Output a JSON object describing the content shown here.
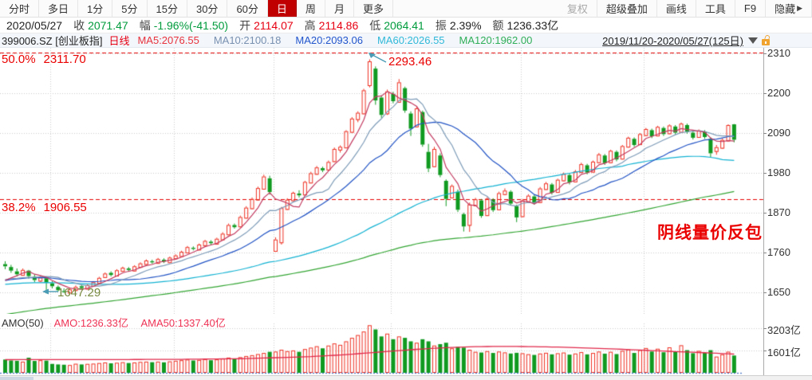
{
  "toolbar": {
    "periods": [
      "分时",
      "多日",
      "1分",
      "5分",
      "15分",
      "30分",
      "60分",
      "日",
      "周",
      "月",
      "更多"
    ],
    "selected": "日",
    "right_items": [
      "复权",
      "超级叠加",
      "画线",
      "工具",
      "F9",
      "隐藏"
    ],
    "disabled_item": "复权",
    "hide_arrow": "▶"
  },
  "info_bar": {
    "date": "2020/05/27",
    "fields": [
      {
        "label": "收",
        "value": "2071.47",
        "tone": "down"
      },
      {
        "label": "幅",
        "value": "-1.96%(-41.50)",
        "tone": "down"
      },
      {
        "label": "开",
        "value": "2114.07",
        "tone": "up"
      },
      {
        "label": "高",
        "value": "2114.86",
        "tone": "up"
      },
      {
        "label": "低",
        "value": "2064.41",
        "tone": "down"
      },
      {
        "label": "振",
        "value": "2.39%",
        "tone": "flat"
      },
      {
        "label": "额",
        "value": "1236.33亿",
        "tone": "flat"
      }
    ]
  },
  "indicator_bar": {
    "code_name": "399006.SZ [创业板指]",
    "period_label": "日线",
    "ma_labels": [
      {
        "text": "MA5:2076.55",
        "color": "#e8323c"
      },
      {
        "text": "MA10:2100.18",
        "color": "#7890b0"
      },
      {
        "text": "MA20:2093.06",
        "color": "#2255cc"
      },
      {
        "text": "MA60:2026.55",
        "color": "#30b8d8"
      },
      {
        "text": "MA120:1962.00",
        "color": "#2fae57"
      }
    ],
    "range": "2019/11/20-2020/05/27(125日)"
  },
  "annotations": {
    "fib_top_pct": "50.0%",
    "fib_top_price": "2311.70",
    "fib_mid_pct": "38.2%",
    "fib_mid_price": "1906.55",
    "peak_price": "2293.46",
    "low_price": "1647.29",
    "note": "阴线量价反包"
  },
  "volume_panel": {
    "title": "AMO(50)",
    "amo_label": "AMO:1236.33亿",
    "ama_label": "AMA50:1337.40亿",
    "y_labels": [
      "3203亿",
      "1601亿"
    ]
  },
  "y_axis_price_labels": [
    "2310",
    "2200",
    "2090",
    "1980",
    "1870",
    "1760",
    "1650"
  ],
  "chart_data": {
    "type": "candlestick+volume",
    "symbol": "399006.SZ",
    "period": "daily",
    "price_axis": {
      "levels": [
        2310,
        2200,
        2090,
        1980,
        1870,
        1760,
        1650
      ],
      "fib_lines": [
        2311.7,
        1906.55
      ]
    },
    "volume_axis": {
      "levels": [
        3203,
        1601
      ],
      "unit": "亿"
    },
    "month_grid_bars": [
      8,
      29,
      46,
      66,
      88,
      109
    ],
    "colors": {
      "up": "#ee3224",
      "down": "#109a20",
      "fib": "#e60000",
      "grid": "#cccccc",
      "ma5": "#c23a60",
      "ma10": "#7e9cb8",
      "ma20": "#2153c4",
      "ma60": "#12b2d2",
      "ma120": "#33a533",
      "ama50": "#e0284a",
      "vol_baseline": "#4a78c8",
      "arrow": "#4a9bb5"
    },
    "candles": [
      [
        1728,
        1736,
        1714,
        1722
      ],
      [
        1720,
        1726,
        1704,
        1710
      ],
      [
        1708,
        1716,
        1694,
        1700
      ],
      [
        1698,
        1716,
        1696,
        1712
      ],
      [
        1710,
        1712,
        1688,
        1695
      ],
      [
        1693,
        1700,
        1678,
        1684
      ],
      [
        1682,
        1696,
        1679,
        1691
      ],
      [
        1689,
        1693,
        1647.29,
        1677
      ],
      [
        1675,
        1681,
        1661,
        1667
      ],
      [
        1665,
        1669,
        1652,
        1656
      ],
      [
        1654,
        1661,
        1648,
        1651
      ],
      [
        1649,
        1662,
        1647.5,
        1658
      ],
      [
        1656,
        1669,
        1654,
        1665
      ],
      [
        1667,
        1671,
        1657,
        1662
      ],
      [
        1660,
        1674,
        1658,
        1670
      ],
      [
        1668,
        1681,
        1666,
        1678
      ],
      [
        1676,
        1693,
        1674,
        1690
      ],
      [
        1692,
        1705,
        1690,
        1702
      ],
      [
        1704,
        1708,
        1694,
        1698
      ],
      [
        1696,
        1714,
        1694,
        1711
      ],
      [
        1709,
        1721,
        1707,
        1718
      ],
      [
        1716,
        1720,
        1708,
        1712
      ],
      [
        1710,
        1725,
        1708,
        1722
      ],
      [
        1720,
        1733,
        1718,
        1730
      ],
      [
        1728,
        1741,
        1726,
        1738
      ],
      [
        1736,
        1740,
        1729,
        1733
      ],
      [
        1731,
        1745,
        1729,
        1742
      ],
      [
        1740,
        1744,
        1731,
        1735
      ],
      [
        1733,
        1749,
        1731,
        1746
      ],
      [
        1744,
        1755,
        1742,
        1752
      ],
      [
        1750,
        1765,
        1748,
        1762
      ],
      [
        1760,
        1778,
        1758,
        1775
      ],
      [
        1773,
        1777,
        1766,
        1770
      ],
      [
        1768,
        1785,
        1766,
        1782
      ],
      [
        1780,
        1795,
        1778,
        1792
      ],
      [
        1790,
        1794,
        1782,
        1786
      ],
      [
        1784,
        1801,
        1782,
        1798
      ],
      [
        1796,
        1816,
        1794,
        1812
      ],
      [
        1810,
        1840,
        1808,
        1836
      ],
      [
        1836,
        1840,
        1826,
        1830
      ],
      [
        1832,
        1862,
        1830,
        1858
      ],
      [
        1856,
        1888,
        1854,
        1884
      ],
      [
        1882,
        1912,
        1880,
        1908
      ],
      [
        1906,
        1942,
        1904,
        1938
      ],
      [
        1936,
        1975,
        1934,
        1970
      ],
      [
        1965,
        1972,
        1920,
        1927
      ],
      [
        1764.4,
        1802,
        1764.4,
        1795.8
      ],
      [
        1788,
        1886,
        1782,
        1882.7
      ],
      [
        1880,
        1910,
        1878,
        1906
      ],
      [
        1904,
        1928,
        1902,
        1925
      ],
      [
        1923,
        1932,
        1912,
        1918
      ],
      [
        1920,
        1958,
        1918,
        1955
      ],
      [
        1953,
        1983,
        1951,
        1979
      ],
      [
        1977,
        1999,
        1975,
        1995
      ],
      [
        1993,
        1997,
        1982,
        1987
      ],
      [
        1989,
        2014,
        1987,
        2010
      ],
      [
        2012,
        2050,
        2010,
        2046
      ],
      [
        2044,
        2056,
        2036,
        2052
      ],
      [
        2050,
        2098,
        2048,
        2095
      ],
      [
        2093,
        2134,
        2091,
        2130
      ],
      [
        2128,
        2150,
        2120,
        2146
      ],
      [
        2144,
        2212,
        2142,
        2208
      ],
      [
        2222,
        2293.46,
        2216,
        2288
      ],
      [
        2268,
        2274,
        2168,
        2180
      ],
      [
        2188,
        2194,
        2132,
        2140
      ],
      [
        2144,
        2210,
        2140,
        2205
      ],
      [
        2198,
        2204,
        2172,
        2178
      ],
      [
        2176,
        2239,
        2174,
        2230
      ],
      [
        2214,
        2218,
        2146,
        2152
      ],
      [
        2144,
        2150,
        2082,
        2102
      ],
      [
        2108,
        2162,
        2106,
        2158
      ],
      [
        2148,
        2152,
        2052,
        2058
      ],
      [
        2038,
        2060,
        1982,
        1992
      ],
      [
        1998,
        2052,
        1996,
        2046
      ],
      [
        2028,
        2034,
        1968,
        1974
      ],
      [
        1958,
        1962,
        1888,
        1908
      ],
      [
        1912,
        1948,
        1910,
        1944
      ],
      [
        1928,
        1934,
        1872,
        1878
      ],
      [
        1866,
        1870,
        1818,
        1832
      ],
      [
        1836,
        1898,
        1817,
        1893
      ],
      [
        1890,
        1911,
        1888,
        1907
      ],
      [
        1904,
        1908,
        1856,
        1861
      ],
      [
        1863,
        1913,
        1861,
        1909
      ],
      [
        1906,
        1910,
        1872,
        1877
      ],
      [
        1879,
        1928,
        1877,
        1924
      ],
      [
        1921,
        1937,
        1919,
        1931
      ],
      [
        1928,
        1932,
        1890,
        1895
      ],
      [
        1888,
        1892,
        1844,
        1857
      ],
      [
        1860,
        1908,
        1858,
        1904
      ],
      [
        1901,
        1921,
        1899,
        1917
      ],
      [
        1915,
        1919,
        1892,
        1897
      ],
      [
        1899,
        1941,
        1897,
        1937
      ],
      [
        1935,
        1955,
        1933,
        1951
      ],
      [
        1948,
        1952,
        1920,
        1925
      ],
      [
        1927,
        1964,
        1925,
        1961
      ],
      [
        1959,
        1981,
        1957,
        1977
      ],
      [
        1974,
        1978,
        1948,
        1954
      ],
      [
        1956,
        1988,
        1954,
        1984
      ],
      [
        1982,
        2008,
        1980,
        2004
      ],
      [
        2001,
        2005,
        1976,
        1981
      ],
      [
        1983,
        2014,
        1981,
        2011
      ],
      [
        2009,
        2035,
        2007,
        2031
      ],
      [
        2028,
        2032,
        2002,
        2007
      ],
      [
        2009,
        2044,
        2007,
        2041
      ],
      [
        2038,
        2042,
        2012,
        2017
      ],
      [
        2019,
        2057,
        2017,
        2054
      ],
      [
        2052,
        2080,
        2050,
        2077
      ],
      [
        2074,
        2078,
        2052,
        2057
      ],
      [
        2059,
        2090,
        2057,
        2087
      ],
      [
        2084,
        2104,
        2082,
        2101
      ],
      [
        2098,
        2102,
        2076,
        2081
      ],
      [
        2083,
        2110,
        2081,
        2107
      ],
      [
        2104,
        2108,
        2082,
        2087
      ],
      [
        2089,
        2114,
        2087,
        2111
      ],
      [
        2108,
        2112,
        2086,
        2091
      ],
      [
        2093,
        2119,
        2091,
        2116
      ],
      [
        2112,
        2116,
        2088,
        2094
      ],
      [
        2091,
        2095,
        2072,
        2077
      ],
      [
        2079,
        2100,
        2077,
        2097
      ],
      [
        2094,
        2098,
        2074,
        2079
      ],
      [
        2074,
        2078,
        2024,
        2034
      ],
      [
        2040,
        2057,
        2030,
        2051
      ],
      [
        2049,
        2075,
        2047,
        2071
      ],
      [
        2069,
        2114,
        2067,
        2112
      ],
      [
        2114.07,
        2114.86,
        2064.41,
        2071.47
      ]
    ],
    "volumes": [
      950,
      880,
      860,
      800,
      1080,
      850,
      900,
      870,
      640,
      600,
      580,
      560,
      650,
      600,
      640,
      660,
      700,
      740,
      680,
      720,
      760,
      700,
      740,
      780,
      800,
      760,
      800,
      750,
      820,
      860,
      900,
      950,
      880,
      920,
      980,
      900,
      960,
      1020,
      1090,
      1000,
      1120,
      1200,
      1260,
      1340,
      1420,
      1500,
      1520,
      1650,
      1550,
      1600,
      1500,
      1700,
      1800,
      1900,
      1750,
      1950,
      2100,
      2000,
      2250,
      2500,
      2700,
      2950,
      3400,
      3100,
      2600,
      2800,
      2400,
      2600,
      2500,
      2250,
      2150,
      2400,
      2250,
      1950,
      2050,
      2150,
      1750,
      1850,
      1800,
      1650,
      1500,
      1450,
      1550,
      1420,
      1520,
      1460,
      1380,
      1430,
      1400,
      1330,
      1280,
      1380,
      1430,
      1320,
      1400,
      1450,
      1300,
      1380,
      1480,
      1320,
      1420,
      1520,
      1370,
      1500,
      1340,
      1570,
      1670,
      1420,
      1620,
      1770,
      1520,
      1720,
      1470,
      1820,
      1520,
      1970,
      1620,
      1400,
      1570,
      1420,
      1620,
      1160,
      1320,
      1510,
      1236.33
    ],
    "ma_seed_closes_before_window": [
      1392,
      1398,
      1405,
      1398,
      1410,
      1418,
      1412,
      1425,
      1432,
      1428,
      1438,
      1445,
      1440,
      1452,
      1448,
      1460,
      1455,
      1468,
      1475,
      1470,
      1462,
      1455,
      1470,
      1478,
      1472,
      1485,
      1492,
      1488,
      1478,
      1470,
      1480,
      1492,
      1500,
      1495,
      1508,
      1515,
      1510,
      1522,
      1515,
      1528,
      1535,
      1530,
      1542,
      1550,
      1545,
      1558,
      1565,
      1560,
      1572,
      1580,
      1575,
      1588,
      1595,
      1605,
      1598,
      1610,
      1618,
      1612,
      1625,
      1632,
      1628,
      1640,
      1648,
      1655,
      1650,
      1662,
      1670,
      1665,
      1678,
      1685,
      1680,
      1692,
      1700,
      1708,
      1702,
      1715,
      1710,
      1718,
      1712,
      1705,
      1698,
      1690,
      1682,
      1675,
      1668,
      1660,
      1652,
      1645,
      1650,
      1642,
      1635,
      1628,
      1620,
      1628,
      1635,
      1630,
      1642,
      1650,
      1645,
      1655,
      1662,
      1658,
      1668,
      1675,
      1670,
      1680,
      1688,
      1682,
      1692,
      1698,
      1692,
      1685,
      1690,
      1695,
      1688,
      1682,
      1676,
      1670,
      1675,
      1672
    ],
    "ama50_points": [
      [
        0,
        940
      ],
      [
        10,
        945
      ],
      [
        20,
        950
      ],
      [
        30,
        965
      ],
      [
        40,
        1010
      ],
      [
        46,
        1080
      ],
      [
        52,
        1160
      ],
      [
        58,
        1300
      ],
      [
        62,
        1430
      ],
      [
        66,
        1560
      ],
      [
        70,
        1680
      ],
      [
        75,
        1800
      ],
      [
        80,
        1870
      ],
      [
        85,
        1890
      ],
      [
        90,
        1870
      ],
      [
        95,
        1830
      ],
      [
        100,
        1760
      ],
      [
        105,
        1680
      ],
      [
        110,
        1590
      ],
      [
        115,
        1500
      ],
      [
        120,
        1420
      ],
      [
        124,
        1337.4
      ]
    ]
  }
}
